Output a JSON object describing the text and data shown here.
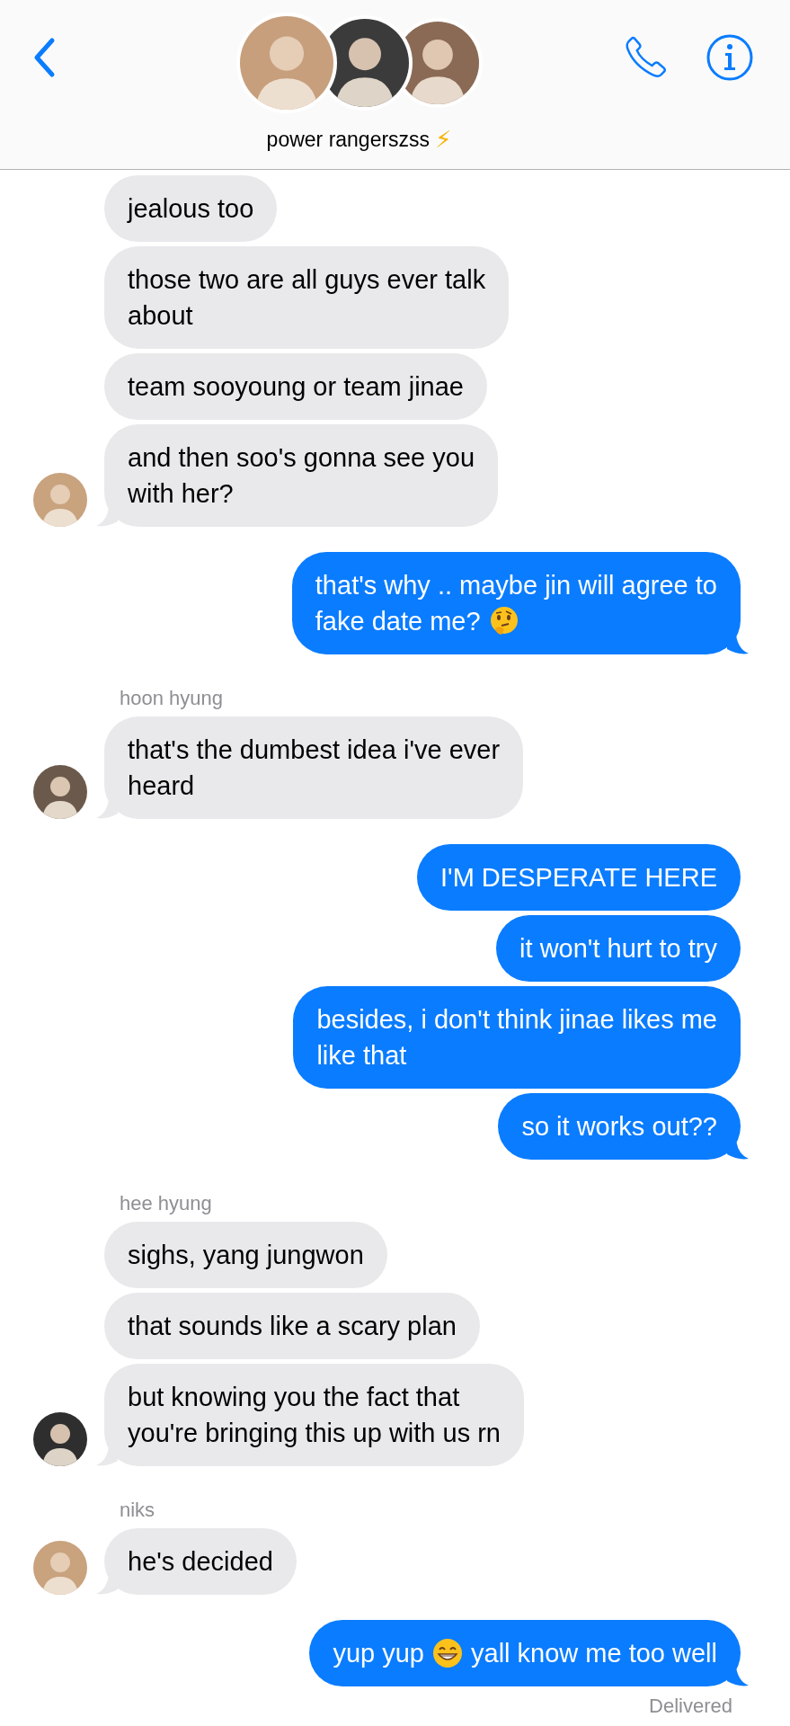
{
  "header": {
    "title": "power rangerszss",
    "title_icon": "⚡",
    "avatars": [
      {
        "color": "#c79f7c"
      },
      {
        "color": "#3b3b3b"
      },
      {
        "color": "#8a6a55"
      }
    ]
  },
  "groups": [
    {
      "kind": "incoming",
      "avatar": {
        "color": "#c9a27e"
      },
      "bubbles": [
        {
          "lines": [
            [
              {
                "text": "jealous too"
              }
            ]
          ]
        },
        {
          "lines": [
            [
              {
                "text": "those two are all guys ever talk"
              }
            ],
            [
              {
                "text": "about"
              }
            ]
          ]
        },
        {
          "lines": [
            [
              {
                "text": "team sooyoung or team jinae"
              }
            ]
          ]
        },
        {
          "lines": [
            [
              {
                "text": "and then soo's gonna see you"
              }
            ],
            [
              {
                "text": "with her?"
              }
            ]
          ]
        }
      ]
    },
    {
      "kind": "outgoing",
      "bubbles": [
        {
          "lines": [
            [
              {
                "text": "that's why .. maybe jin will agree to"
              }
            ],
            [
              {
                "text": "fake date me?"
              },
              {
                "kind": "thinking"
              }
            ]
          ]
        }
      ]
    },
    {
      "kind": "incoming",
      "sender": "hoon hyung",
      "avatar": {
        "color": "#6b5a4c"
      },
      "bubbles": [
        {
          "lines": [
            [
              {
                "text": "that's the dumbest idea i've ever"
              }
            ],
            [
              {
                "text": "heard"
              }
            ]
          ]
        }
      ]
    },
    {
      "kind": "outgoing",
      "bubbles": [
        {
          "lines": [
            [
              {
                "text": "I'M DESPERATE HERE"
              }
            ]
          ]
        },
        {
          "lines": [
            [
              {
                "text": "it won't hurt to try"
              }
            ]
          ]
        },
        {
          "lines": [
            [
              {
                "text": "besides, i don't think jinae likes me"
              }
            ],
            [
              {
                "text": "like that"
              }
            ]
          ]
        },
        {
          "lines": [
            [
              {
                "text": "so it works out??"
              }
            ]
          ]
        }
      ]
    },
    {
      "kind": "incoming",
      "sender": "hee hyung",
      "avatar": {
        "color": "#2e2e2e"
      },
      "bubbles": [
        {
          "lines": [
            [
              {
                "text": "sighs, yang jungwon"
              }
            ]
          ]
        },
        {
          "lines": [
            [
              {
                "text": "that sounds like a scary plan"
              }
            ]
          ]
        },
        {
          "lines": [
            [
              {
                "text": "but knowing you the fact that"
              }
            ],
            [
              {
                "text": "you're bringing this up with us rn"
              }
            ]
          ]
        }
      ]
    },
    {
      "kind": "incoming",
      "sender": "niks",
      "avatar": {
        "color": "#c9a27e"
      },
      "bubbles": [
        {
          "lines": [
            [
              {
                "text": "he's decided"
              }
            ]
          ]
        }
      ]
    },
    {
      "kind": "outgoing",
      "bubbles": [
        {
          "lines": [
            [
              {
                "text": "yup yup"
              },
              {
                "kind": "grin"
              },
              {
                "text": "yall know me too well"
              }
            ]
          ]
        }
      ],
      "status": "Delivered"
    }
  ]
}
